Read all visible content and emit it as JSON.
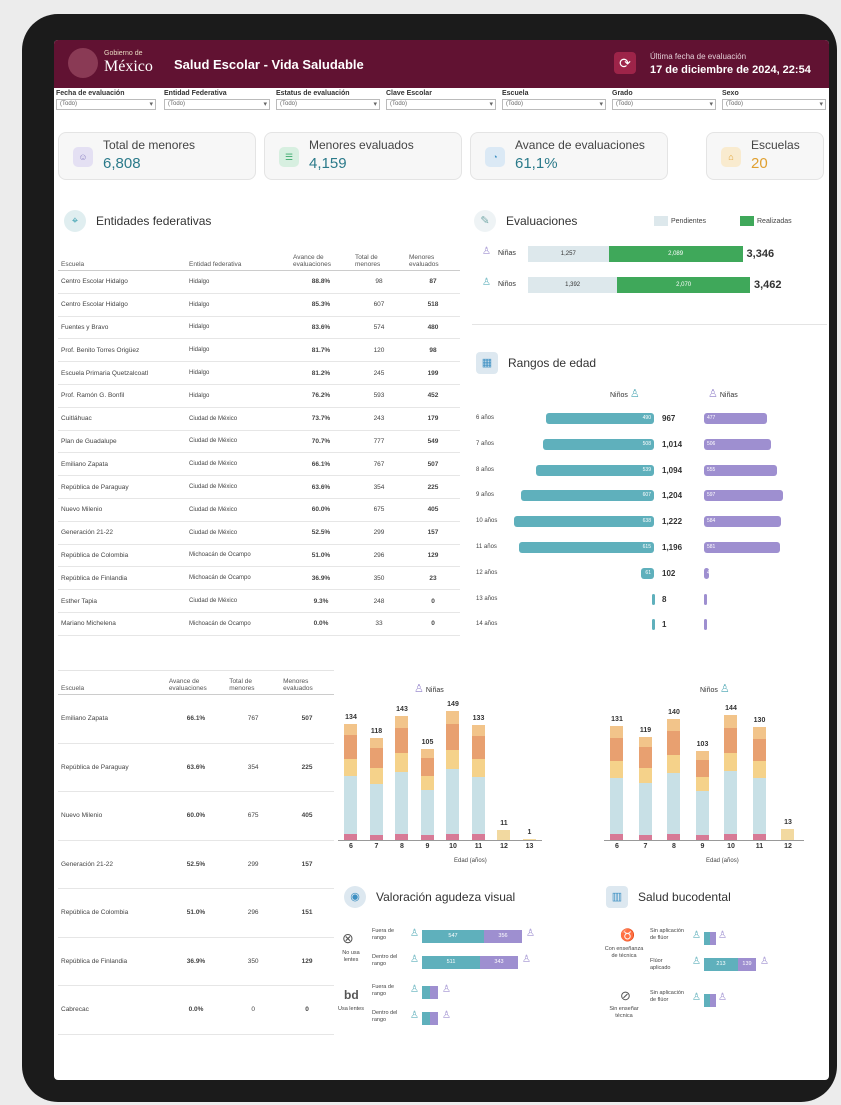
{
  "header": {
    "brand_small": "Gobierno de",
    "brand": "México",
    "title": "Salud Escolar - Vida Saludable",
    "update_label": "Última fecha de evaluación",
    "update_value": "17 de diciembre de 2024, 22:54",
    "refresh_icon": "refresh-icon"
  },
  "filters": [
    {
      "label": "Fecha de evaluación",
      "value": "(Todo)"
    },
    {
      "label": "Entidad Federativa",
      "value": "(Todo)"
    },
    {
      "label": "Estatus de evaluación",
      "value": "(Todo)"
    },
    {
      "label": "Clave Escolar",
      "value": "(Todo)"
    },
    {
      "label": "Escuela",
      "value": "(Todo)"
    },
    {
      "label": "Grado",
      "value": "(Todo)"
    },
    {
      "label": "Sexo",
      "value": "(Todo)"
    }
  ],
  "kpis": [
    {
      "label": "Total de menores",
      "value": "6,808",
      "icon": "children-icon",
      "color": "#8a7fc2"
    },
    {
      "label": "Menores evaluados",
      "value": "4,159",
      "icon": "checklist-icon",
      "color": "#3aa86b"
    },
    {
      "label": "Avance de evaluaciones",
      "value": "61,1%",
      "icon": "progress-icon",
      "color": "#3c8fc2"
    },
    {
      "label": "Escuelas",
      "value": "20",
      "icon": "school-icon",
      "color": "#e0a030"
    }
  ],
  "entidades": {
    "title": "Entidades federativas",
    "headers": [
      "Escuela",
      "Entidad federativa",
      "Avance de evaluaciones",
      "Total de menores",
      "Menores evaluados"
    ],
    "rows": [
      [
        "Centro Escolar Hidalgo",
        "Hidalgo",
        "88.8%",
        "98",
        "87"
      ],
      [
        "Centro Escolar Hidalgo",
        "Hidalgo",
        "85.3%",
        "607",
        "518"
      ],
      [
        "Fuentes y Bravo",
        "Hidalgo",
        "83.6%",
        "574",
        "480"
      ],
      [
        "Prof. Benito Torres Origüez",
        "Hidalgo",
        "81.7%",
        "120",
        "98"
      ],
      [
        "Escuela Primaria Quetzalcoatl",
        "Hidalgo",
        "81.2%",
        "245",
        "199"
      ],
      [
        "Prof. Ramón G. Bonfil",
        "Hidalgo",
        "76.2%",
        "593",
        "452"
      ],
      [
        "Cuitláhuac",
        "Ciudad de México",
        "73.7%",
        "243",
        "179"
      ],
      [
        "Plan de Guadalupe",
        "Ciudad de México",
        "70.7%",
        "777",
        "549"
      ],
      [
        "Emiliano Zapata",
        "Ciudad de México",
        "66.1%",
        "767",
        "507"
      ],
      [
        "República de Paraguay",
        "Ciudad de México",
        "63.6%",
        "354",
        "225"
      ],
      [
        "Nuevo Milenio",
        "Ciudad de México",
        "60.0%",
        "675",
        "405"
      ],
      [
        "Generación 21-22",
        "Ciudad de México",
        "52.5%",
        "299",
        "157"
      ],
      [
        "República de Colombia",
        "Michoacán de Ocampo",
        "51.0%",
        "296",
        "129"
      ],
      [
        "República de Finlandia",
        "Michoacán de Ocampo",
        "36.9%",
        "350",
        "23"
      ],
      [
        "Esther Tapia",
        "Ciudad de México",
        "9.3%",
        "248",
        "0"
      ],
      [
        "Mariano Michelena",
        "Michoacán de Ocampo",
        "0.0%",
        "33",
        "0"
      ]
    ]
  },
  "evaluaciones": {
    "title": "Evaluaciones",
    "legend_pending": "Pendientes",
    "legend_done": "Realizadas",
    "rows": [
      {
        "label": "Niñas",
        "pending": "1,257",
        "done": "2,089",
        "total": "3,346",
        "pending_n": 1257,
        "done_n": 2089
      },
      {
        "label": "Niños",
        "pending": "1,392",
        "done": "2,070",
        "total": "3,462",
        "pending_n": 1392,
        "done_n": 2070
      }
    ]
  },
  "rangos": {
    "title": "Rangos de edad",
    "ninos_label": "Niños",
    "ninas_label": "Niñas",
    "rows": [
      {
        "age": "6 años",
        "ninos": "490",
        "total": "967",
        "ninas": "477",
        "ninos_n": 490,
        "ninas_n": 477
      },
      {
        "age": "7 años",
        "ninos": "508",
        "total": "1,014",
        "ninas": "506",
        "ninos_n": 508,
        "ninas_n": 506
      },
      {
        "age": "8 años",
        "ninos": "539",
        "total": "1,094",
        "ninas": "555",
        "ninos_n": 539,
        "ninas_n": 555
      },
      {
        "age": "9 años",
        "ninos": "607",
        "total": "1,204",
        "ninas": "597",
        "ninos_n": 607,
        "ninas_n": 597
      },
      {
        "age": "10 años",
        "ninos": "638",
        "total": "1,222",
        "ninas": "584",
        "ninos_n": 638,
        "ninas_n": 584
      },
      {
        "age": "11 años",
        "ninos": "615",
        "total": "1,196",
        "ninas": "581",
        "ninos_n": 615,
        "ninas_n": 581
      },
      {
        "age": "12 años",
        "ninos": "61",
        "total": "102",
        "ninas": "41",
        "ninos_n": 61,
        "ninas_n": 41
      },
      {
        "age": "13 años",
        "ninos": "",
        "total": "8",
        "ninas": "",
        "ninos_n": 5,
        "ninas_n": 3
      },
      {
        "age": "14 años",
        "ninos": "",
        "total": "1",
        "ninas": "",
        "ninos_n": 1,
        "ninas_n": 0
      }
    ]
  },
  "escuelas2": {
    "headers": [
      "Escuela",
      "Avance de evaluaciones",
      "Total de menores",
      "Menores evaluados"
    ],
    "rows": [
      [
        "Emiliano Zapata",
        "66.1%",
        "767",
        "507"
      ],
      [
        "República de Paraguay",
        "63.6%",
        "354",
        "225"
      ],
      [
        "Nuevo Milenio",
        "60.0%",
        "675",
        "405"
      ],
      [
        "Generación 21-22",
        "52.5%",
        "299",
        "157"
      ],
      [
        "República de Colombia",
        "51.0%",
        "296",
        "151"
      ],
      [
        "República de Finlandia",
        "36.9%",
        "350",
        "129"
      ],
      [
        "Cabrecac",
        "0.0%",
        "0",
        "0"
      ]
    ]
  },
  "chart_data": [
    {
      "type": "bar",
      "title": "Niñas",
      "xlabel": "Edad (años)",
      "categories": [
        "6",
        "7",
        "8",
        "9",
        "10",
        "11",
        "12",
        "13"
      ],
      "values": [
        134,
        118,
        143,
        105,
        149,
        133,
        11,
        1
      ]
    },
    {
      "type": "bar",
      "title": "Niños",
      "xlabel": "Edad (años)",
      "categories": [
        "6",
        "7",
        "8",
        "9",
        "10",
        "11",
        "12"
      ],
      "values": [
        131,
        119,
        140,
        103,
        144,
        130,
        13
      ]
    }
  ],
  "agudeza": {
    "title": "Valoración agudeza visual",
    "group1": "No usa lentes",
    "group2": "Usa lentes",
    "row_out": "Fuera de rango",
    "row_in": "Dentro del rango",
    "no_lentes_out": [
      "547",
      "356"
    ],
    "no_lentes_in": [
      "511",
      "343"
    ]
  },
  "bucodental": {
    "title": "Salud bucodental",
    "group1": "Con enseñanza de técnica",
    "group2": "Sin enseñar técnica",
    "row_sin": "Sin aplicación de flúor",
    "row_con": "Flúor aplicado",
    "con_values": [
      "213",
      "139"
    ]
  }
}
